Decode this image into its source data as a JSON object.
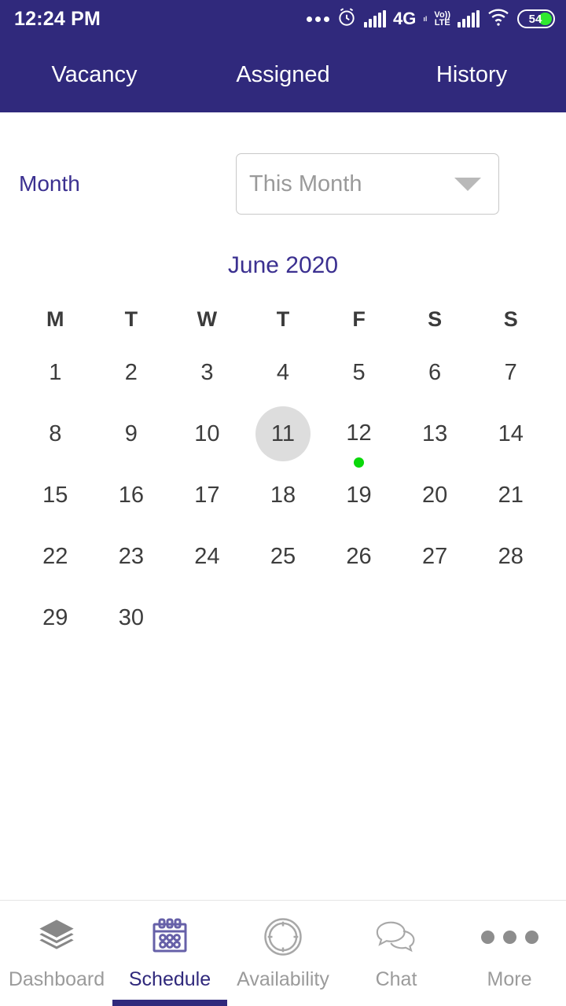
{
  "status_bar": {
    "time": "12:24 PM",
    "icons": [
      "more-dots-icon",
      "alarm-icon",
      "signal-icon",
      "4g-icon",
      "volte-icon",
      "signal-icon-2",
      "wifi-icon",
      "battery-icon"
    ],
    "network_label": "4G",
    "network_sub": "ıl",
    "volte_top": "Vo))",
    "volte_bottom": "LTE",
    "battery_percent": "54",
    "battery_color": "#2fe82f"
  },
  "tabs": {
    "items": [
      {
        "label": "Vacancy",
        "active": false
      },
      {
        "label": "Assigned",
        "active": false
      },
      {
        "label": "History",
        "active": true
      }
    ],
    "bar_color": "#30297c"
  },
  "filter": {
    "label": "Month",
    "select_value": "This Month",
    "select_placeholder": "This Month",
    "caret_icon": "chevron-down-icon"
  },
  "calendar": {
    "title": "June 2020",
    "weekdays": [
      "M",
      "T",
      "W",
      "T",
      "F",
      "S",
      "S"
    ],
    "leading_blanks": 0,
    "days": [
      {
        "n": "1"
      },
      {
        "n": "2"
      },
      {
        "n": "3"
      },
      {
        "n": "4"
      },
      {
        "n": "5"
      },
      {
        "n": "6"
      },
      {
        "n": "7"
      },
      {
        "n": "8"
      },
      {
        "n": "9"
      },
      {
        "n": "10"
      },
      {
        "n": "11",
        "today": true
      },
      {
        "n": "12",
        "dot": true
      },
      {
        "n": "13"
      },
      {
        "n": "14"
      },
      {
        "n": "15"
      },
      {
        "n": "16"
      },
      {
        "n": "17"
      },
      {
        "n": "18"
      },
      {
        "n": "19"
      },
      {
        "n": "20"
      },
      {
        "n": "21"
      },
      {
        "n": "22"
      },
      {
        "n": "23"
      },
      {
        "n": "24"
      },
      {
        "n": "25"
      },
      {
        "n": "26"
      },
      {
        "n": "27"
      },
      {
        "n": "28"
      },
      {
        "n": "29"
      },
      {
        "n": "30"
      }
    ],
    "today_highlight_color": "#dddddd",
    "event_dot_color": "#0ad80a",
    "title_color": "#3b3090"
  },
  "bottom_nav": {
    "items": [
      {
        "label": "Dashboard",
        "icon": "layers-icon",
        "active": false
      },
      {
        "label": "Schedule",
        "icon": "calendar-icon",
        "active": true
      },
      {
        "label": "Availability",
        "icon": "clock-circle-icon",
        "active": false
      },
      {
        "label": "Chat",
        "icon": "speech-bubbles-icon",
        "active": false
      },
      {
        "label": "More",
        "icon": "ellipsis-icon",
        "active": false
      }
    ],
    "active_color": "#30297c",
    "inactive_color": "#9b9b9b"
  }
}
